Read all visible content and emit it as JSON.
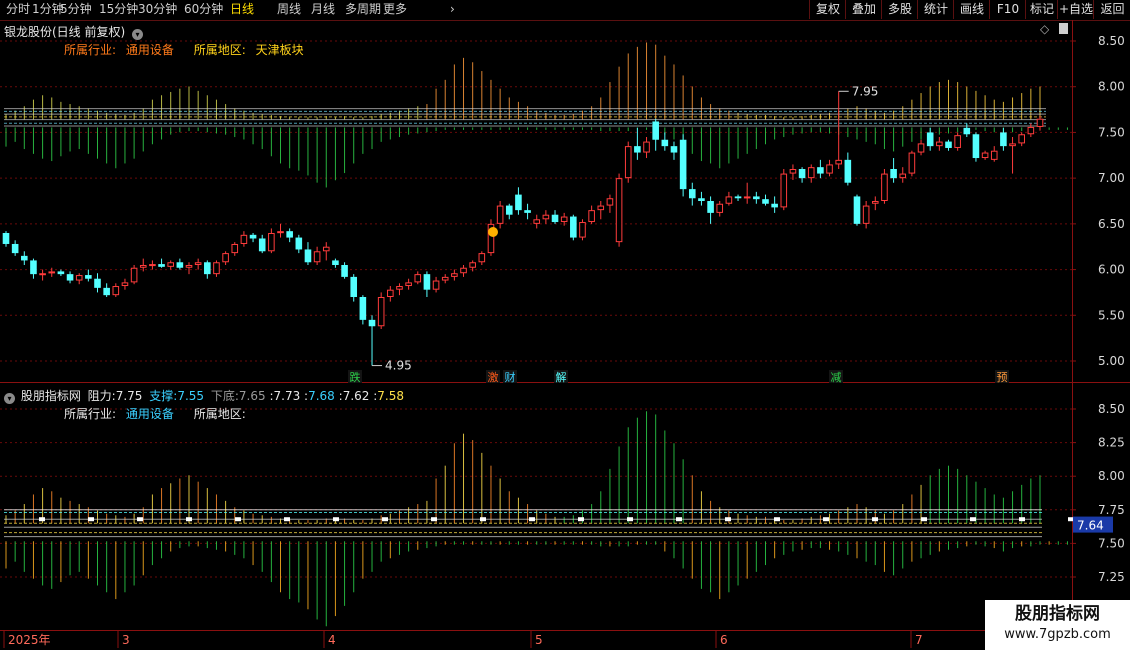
{
  "toolbar": {
    "left": [
      "分时",
      "1分钟",
      "5分钟",
      "15分钟",
      "30分钟",
      "60分钟",
      "日线",
      "周线",
      "月线",
      "多周期",
      "更多"
    ],
    "active": "日线",
    "right": [
      "复权",
      "叠加",
      "多股",
      "统计",
      "画线",
      "F10",
      "标记",
      "+自选",
      "返回"
    ]
  },
  "main_header": {
    "title": "银龙股份(日线 前复权)",
    "industry_label": "所属行业:",
    "industry": "通用设备",
    "region_label": "所属地区:",
    "region": "天津板块"
  },
  "sub_header": {
    "title": "股朋指标网",
    "resist_label": "阻力:",
    "resist": "7.75",
    "support_label": "支撑:",
    "support": "7.55",
    "bottom_label": "下底:",
    "bottom": "7.65",
    "v1": "7.73",
    "v2": "7.68",
    "v3": "7.62",
    "v4": "7.58",
    "industry_label": "所属行业:",
    "industry": "通用设备",
    "region_label": "所属地区:"
  },
  "current_value": "7.64",
  "watermark": {
    "name": "股朋指标网",
    "url": "www.7gpzb.com"
  },
  "colors": {
    "up": "#ff3c3c",
    "down": "#54ffff",
    "grid": "#6a0a0a",
    "axis": "#8a1010",
    "label": "#c8c8c8",
    "flat": "#ffffff"
  },
  "chart_data": [
    {
      "type": "candlestick",
      "title": "银龙股份(日线 前复权)",
      "ylim": [
        4.8,
        8.7
      ],
      "yticks": [
        "8.50",
        "8.00",
        "7.50",
        "7.00",
        "6.50",
        "6.00",
        "5.50",
        "5.00"
      ],
      "x_labels": [
        "2025年",
        "3",
        "4",
        "5",
        "6",
        "7"
      ],
      "annotations": [
        {
          "text": "7.95",
          "value": 7.95,
          "kind": "high"
        },
        {
          "text": "4.95",
          "value": 4.95,
          "kind": "low"
        }
      ],
      "markers": [
        "跌",
        "激",
        "财",
        "解",
        "减",
        "预"
      ],
      "ohlc": [
        [
          6.4,
          6.42,
          6.25,
          6.28
        ],
        [
          6.28,
          6.32,
          6.15,
          6.18
        ],
        [
          6.15,
          6.2,
          6.05,
          6.1
        ],
        [
          6.1,
          6.12,
          5.9,
          5.95
        ],
        [
          5.95,
          6.0,
          5.88,
          5.96
        ],
        [
          5.96,
          6.02,
          5.92,
          5.98
        ],
        [
          5.98,
          6.0,
          5.93,
          5.95
        ],
        [
          5.95,
          5.98,
          5.85,
          5.88
        ],
        [
          5.88,
          5.96,
          5.84,
          5.94
        ],
        [
          5.94,
          6.0,
          5.87,
          5.9
        ],
        [
          5.9,
          5.96,
          5.75,
          5.8
        ],
        [
          5.8,
          5.85,
          5.7,
          5.72
        ],
        [
          5.72,
          5.85,
          5.7,
          5.82
        ],
        [
          5.82,
          5.9,
          5.78,
          5.86
        ],
        [
          5.86,
          6.05,
          5.84,
          6.02
        ],
        [
          6.02,
          6.12,
          5.98,
          6.05
        ],
        [
          6.05,
          6.1,
          6.0,
          6.06
        ],
        [
          6.06,
          6.12,
          6.02,
          6.03
        ],
        [
          6.03,
          6.1,
          6.0,
          6.08
        ],
        [
          6.08,
          6.12,
          6.0,
          6.02
        ],
        [
          6.02,
          6.08,
          5.95,
          6.05
        ],
        [
          6.05,
          6.12,
          6.0,
          6.08
        ],
        [
          6.08,
          6.1,
          5.9,
          5.95
        ],
        [
          5.95,
          6.1,
          5.92,
          6.08
        ],
        [
          6.08,
          6.2,
          6.05,
          6.18
        ],
        [
          6.18,
          6.3,
          6.15,
          6.28
        ],
        [
          6.28,
          6.42,
          6.25,
          6.38
        ],
        [
          6.38,
          6.4,
          6.3,
          6.34
        ],
        [
          6.34,
          6.38,
          6.18,
          6.2
        ],
        [
          6.2,
          6.45,
          6.18,
          6.4
        ],
        [
          6.4,
          6.5,
          6.35,
          6.42
        ],
        [
          6.42,
          6.45,
          6.3,
          6.35
        ],
        [
          6.35,
          6.38,
          6.18,
          6.22
        ],
        [
          6.22,
          6.3,
          6.05,
          6.08
        ],
        [
          6.08,
          6.25,
          6.05,
          6.2
        ],
        [
          6.2,
          6.3,
          6.1,
          6.25
        ],
        [
          6.1,
          6.12,
          6.02,
          6.05
        ],
        [
          6.05,
          6.08,
          5.9,
          5.92
        ],
        [
          5.92,
          5.95,
          5.65,
          5.7
        ],
        [
          5.7,
          5.72,
          5.4,
          5.45
        ],
        [
          5.45,
          5.5,
          4.95,
          5.38
        ],
        [
          5.38,
          5.75,
          5.35,
          5.7
        ],
        [
          5.7,
          5.82,
          5.65,
          5.78
        ],
        [
          5.78,
          5.85,
          5.72,
          5.82
        ],
        [
          5.82,
          5.9,
          5.78,
          5.86
        ],
        [
          5.86,
          5.98,
          5.84,
          5.95
        ],
        [
          5.95,
          5.98,
          5.7,
          5.78
        ],
        [
          5.78,
          5.92,
          5.75,
          5.88
        ],
        [
          5.88,
          5.95,
          5.85,
          5.92
        ],
        [
          5.92,
          6.0,
          5.88,
          5.96
        ],
        [
          5.96,
          6.05,
          5.92,
          6.02
        ],
        [
          6.02,
          6.1,
          5.98,
          6.08
        ],
        [
          6.08,
          6.2,
          6.05,
          6.18
        ],
        [
          6.18,
          6.55,
          6.15,
          6.5
        ],
        [
          6.5,
          6.75,
          6.45,
          6.7
        ],
        [
          6.7,
          6.72,
          6.55,
          6.6
        ],
        [
          6.82,
          6.9,
          6.6,
          6.65
        ],
        [
          6.65,
          6.72,
          6.55,
          6.62
        ],
        [
          6.5,
          6.6,
          6.45,
          6.55
        ],
        [
          6.55,
          6.65,
          6.5,
          6.6
        ],
        [
          6.6,
          6.65,
          6.5,
          6.52
        ],
        [
          6.52,
          6.62,
          6.48,
          6.58
        ],
        [
          6.58,
          6.6,
          6.32,
          6.35
        ],
        [
          6.35,
          6.55,
          6.32,
          6.52
        ],
        [
          6.52,
          6.7,
          6.5,
          6.65
        ],
        [
          6.65,
          6.75,
          6.55,
          6.7
        ],
        [
          6.7,
          6.82,
          6.62,
          6.78
        ],
        [
          6.3,
          7.05,
          6.25,
          7.0
        ],
        [
          7.0,
          7.4,
          6.95,
          7.35
        ],
        [
          7.35,
          7.55,
          7.2,
          7.28
        ],
        [
          7.28,
          7.45,
          7.22,
          7.4
        ],
        [
          7.62,
          7.65,
          7.3,
          7.42
        ],
        [
          7.42,
          7.5,
          7.3,
          7.35
        ],
        [
          7.35,
          7.4,
          7.2,
          7.28
        ],
        [
          7.42,
          7.48,
          6.8,
          6.88
        ],
        [
          6.88,
          6.95,
          6.7,
          6.78
        ],
        [
          6.78,
          6.85,
          6.7,
          6.75
        ],
        [
          6.75,
          6.8,
          6.5,
          6.62
        ],
        [
          6.62,
          6.75,
          6.58,
          6.72
        ],
        [
          6.72,
          6.85,
          6.7,
          6.8
        ],
        [
          6.8,
          6.82,
          6.75,
          6.78
        ],
        [
          6.78,
          6.95,
          6.72,
          6.8
        ],
        [
          6.8,
          6.85,
          6.72,
          6.77
        ],
        [
          6.77,
          6.82,
          6.7,
          6.72
        ],
        [
          6.72,
          6.8,
          6.62,
          6.68
        ],
        [
          6.68,
          7.1,
          6.65,
          7.05
        ],
        [
          7.05,
          7.15,
          6.98,
          7.1
        ],
        [
          7.1,
          7.12,
          6.95,
          7.0
        ],
        [
          7.0,
          7.15,
          6.95,
          7.12
        ],
        [
          7.12,
          7.2,
          7.0,
          7.05
        ],
        [
          7.05,
          7.2,
          7.02,
          7.15
        ],
        [
          7.15,
          7.95,
          7.1,
          7.2
        ],
        [
          7.2,
          7.28,
          6.92,
          6.95
        ],
        [
          6.8,
          6.82,
          6.48,
          6.5
        ],
        [
          6.5,
          6.75,
          6.45,
          6.7
        ],
        [
          6.72,
          6.8,
          6.65,
          6.75
        ],
        [
          6.75,
          7.1,
          6.72,
          7.05
        ],
        [
          7.1,
          7.22,
          6.95,
          7.0
        ],
        [
          7.0,
          7.12,
          6.95,
          7.05
        ],
        [
          7.05,
          7.3,
          7.02,
          7.28
        ],
        [
          7.28,
          7.42,
          7.25,
          7.38
        ],
        [
          7.5,
          7.55,
          7.3,
          7.35
        ],
        [
          7.35,
          7.45,
          7.3,
          7.4
        ],
        [
          7.4,
          7.42,
          7.3,
          7.33
        ],
        [
          7.33,
          7.5,
          7.3,
          7.47
        ],
        [
          7.55,
          7.6,
          7.45,
          7.48
        ],
        [
          7.48,
          7.5,
          7.18,
          7.22
        ],
        [
          7.22,
          7.3,
          7.2,
          7.28
        ],
        [
          7.2,
          7.35,
          7.18,
          7.3
        ],
        [
          7.5,
          7.55,
          7.3,
          7.35
        ],
        [
          7.35,
          7.45,
          7.05,
          7.38
        ],
        [
          7.38,
          7.5,
          7.35,
          7.48
        ],
        [
          7.48,
          7.6,
          7.45,
          7.56
        ],
        [
          7.56,
          7.68,
          7.52,
          7.65
        ]
      ],
      "fan_high": [
        0.05,
        0.08,
        0.12,
        0.18,
        0.22,
        0.2,
        0.16,
        0.14,
        0.12,
        0.1,
        0.08,
        0.06,
        0.05,
        0.04,
        0.06,
        0.1,
        0.18,
        0.22,
        0.25,
        0.28,
        0.3,
        0.26,
        0.22,
        0.18,
        0.14,
        0.1,
        0.08,
        0.06,
        0.05,
        0.04,
        0.03,
        0.02,
        0.02,
        0.02,
        0.02,
        0.03,
        0.02,
        0.03,
        0.02,
        0.02,
        0.03,
        0.05,
        0.06,
        0.08,
        0.1,
        0.12,
        0.14,
        0.28,
        0.36,
        0.5,
        0.56,
        0.52,
        0.44,
        0.36,
        0.28,
        0.2,
        0.16,
        0.12,
        0.08,
        0.06,
        0.04,
        0.04,
        0.05,
        0.08,
        0.12,
        0.2,
        0.34,
        0.48,
        0.6,
        0.66,
        0.7,
        0.68,
        0.58,
        0.5,
        0.4,
        0.3,
        0.2,
        0.14,
        0.1,
        0.08,
        0.06,
        0.05,
        0.04,
        0.04,
        0.03,
        0.02,
        0.02,
        0.03,
        0.04,
        0.05,
        0.06,
        0.08,
        0.1,
        0.12,
        0.1,
        0.08,
        0.06,
        0.08,
        0.12,
        0.18,
        0.24,
        0.3,
        0.34,
        0.36,
        0.34,
        0.3,
        0.26,
        0.22,
        0.18,
        0.16,
        0.2,
        0.24,
        0.28,
        0.3
      ],
      "fan_low": [
        0.16,
        0.12,
        0.18,
        0.22,
        0.26,
        0.28,
        0.24,
        0.2,
        0.18,
        0.22,
        0.26,
        0.3,
        0.34,
        0.3,
        0.26,
        0.2,
        0.14,
        0.1,
        0.06,
        0.04,
        0.03,
        0.03,
        0.04,
        0.05,
        0.06,
        0.08,
        0.1,
        0.14,
        0.18,
        0.24,
        0.3,
        0.34,
        0.36,
        0.4,
        0.46,
        0.5,
        0.44,
        0.38,
        0.3,
        0.22,
        0.18,
        0.12,
        0.1,
        0.08,
        0.06,
        0.05,
        0.04,
        0.03,
        0.02,
        0.02,
        0.02,
        0.02,
        0.02,
        0.02,
        0.02,
        0.02,
        0.02,
        0.02,
        0.02,
        0.02,
        0.02,
        0.02,
        0.02,
        0.02,
        0.02,
        0.03,
        0.03,
        0.03,
        0.03,
        0.02,
        0.02,
        0.02,
        0.06,
        0.1,
        0.16,
        0.22,
        0.28,
        0.3,
        0.34,
        0.3,
        0.26,
        0.22,
        0.18,
        0.14,
        0.1,
        0.08,
        0.06,
        0.05,
        0.04,
        0.04,
        0.05,
        0.06,
        0.08,
        0.1,
        0.12,
        0.14,
        0.18,
        0.2,
        0.16,
        0.12,
        0.1,
        0.08,
        0.06,
        0.05,
        0.04,
        0.03,
        0.02,
        0.03,
        0.04,
        0.06,
        0.04,
        0.03,
        0.03,
        0.02,
        0.02,
        0.02,
        0.02
      ]
    },
    {
      "type": "line",
      "title": "股朋指标网",
      "ylim": [
        7.05,
        8.65
      ],
      "yticks": [
        "8.50",
        "8.25",
        "8.00",
        "7.75",
        "7.50",
        "7.25"
      ],
      "levels": {
        "resist": 7.75,
        "support": 7.55,
        "bottom": 7.65,
        "v1": 7.73,
        "v2": 7.68,
        "v3": 7.62,
        "v4": 7.58
      }
    }
  ]
}
